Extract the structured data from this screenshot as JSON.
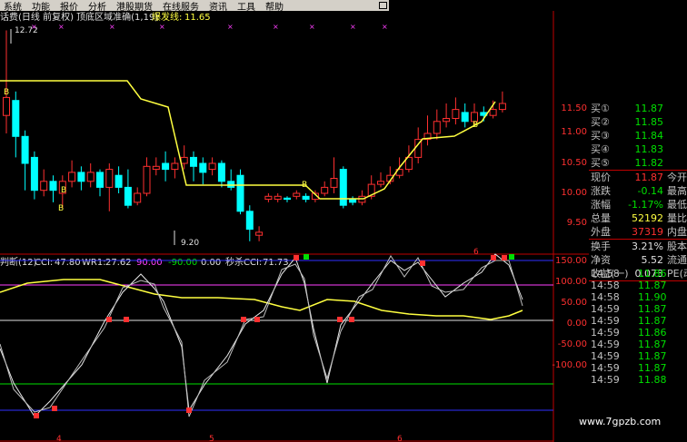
{
  "menu": [
    "系统",
    "功能",
    "报价",
    "分析",
    "港股期货",
    "在线服务",
    "资讯",
    "工具",
    "帮助"
  ],
  "colors": {
    "up": "#ff3030",
    "down": "#00ffff",
    "line_yellow": "#ffff40",
    "line_white": "#e8e8e8",
    "magenta": "#ff40ff",
    "green": "#00e000",
    "axis_red": "#c00000",
    "blue": "#3030ff"
  },
  "main_chart": {
    "title": "话费(日线 前复权) 顶底区域准确(1,19)",
    "indicator_label": "爆发线:",
    "indicator_value": "11.65",
    "high_marker": "12.72",
    "low_marker": "9.20",
    "buy_marker": "B",
    "yaxis_ticks": [
      "11.50",
      "11.00",
      "10.50",
      "10.00",
      "9.50"
    ],
    "red_tick": "6"
  },
  "sub_chart": {
    "label": "判断(12)",
    "cci_label": "CCI:",
    "cci_value": "47.80",
    "wr1_label": "WR1:",
    "wr1_value": "27.62",
    "v1": "90.00",
    "v2": "-90.00",
    "v3": "0.00",
    "sec_label": "秒杀CCI:",
    "sec_value": "71.73",
    "yaxis_ticks": [
      "150.00",
      "100.00",
      "50.00",
      "0.00",
      "-50.00",
      "-100.00"
    ],
    "xaxis_ticks": [
      "4",
      "5",
      "6"
    ]
  },
  "quote_panel": {
    "levels": [
      {
        "label": "买①",
        "price": "11.87"
      },
      {
        "label": "买②",
        "price": "11.85"
      },
      {
        "label": "买③",
        "price": "11.84"
      },
      {
        "label": "买④",
        "price": "11.83"
      },
      {
        "label": "买⑤",
        "price": "11.82"
      }
    ],
    "stats": [
      {
        "label": "现价",
        "value": "11.87",
        "color": "#ff3030",
        "ext": "今开"
      },
      {
        "label": "涨跌",
        "value": "-0.14",
        "color": "#00e000",
        "ext": "最高"
      },
      {
        "label": "涨幅",
        "value": "-1.17%",
        "color": "#00e000",
        "ext": "最低"
      },
      {
        "label": "总量",
        "value": "52192",
        "color": "#ffff40",
        "ext": "量比"
      },
      {
        "label": "外盘",
        "value": "37319",
        "color": "#ff3030",
        "ext": "内盘"
      },
      {
        "label": "换手",
        "value": "3.21%",
        "color": "#e0e0e0",
        "ext": "股本"
      },
      {
        "label": "净资",
        "value": "5.52",
        "color": "#e0e0e0",
        "ext": "流通"
      },
      {
        "label": "收益(一)",
        "value": "0.073",
        "color": "#e0e0e0",
        "ext": "PE(动"
      }
    ],
    "ticks": [
      {
        "time": "14:58",
        "price": "11.86"
      },
      {
        "time": "14:58",
        "price": "11.87"
      },
      {
        "time": "14:58",
        "price": "11.90"
      },
      {
        "time": "14:59",
        "price": "11.87"
      },
      {
        "time": "14:59",
        "price": "11.87"
      },
      {
        "time": "14:59",
        "price": "11.86"
      },
      {
        "time": "14:59",
        "price": "11.87"
      },
      {
        "time": "14:59",
        "price": "11.87"
      },
      {
        "time": "14:59",
        "price": "11.87"
      },
      {
        "time": "14:59",
        "price": "11.88"
      }
    ]
  },
  "watermark": "www.7gpzb.com"
}
